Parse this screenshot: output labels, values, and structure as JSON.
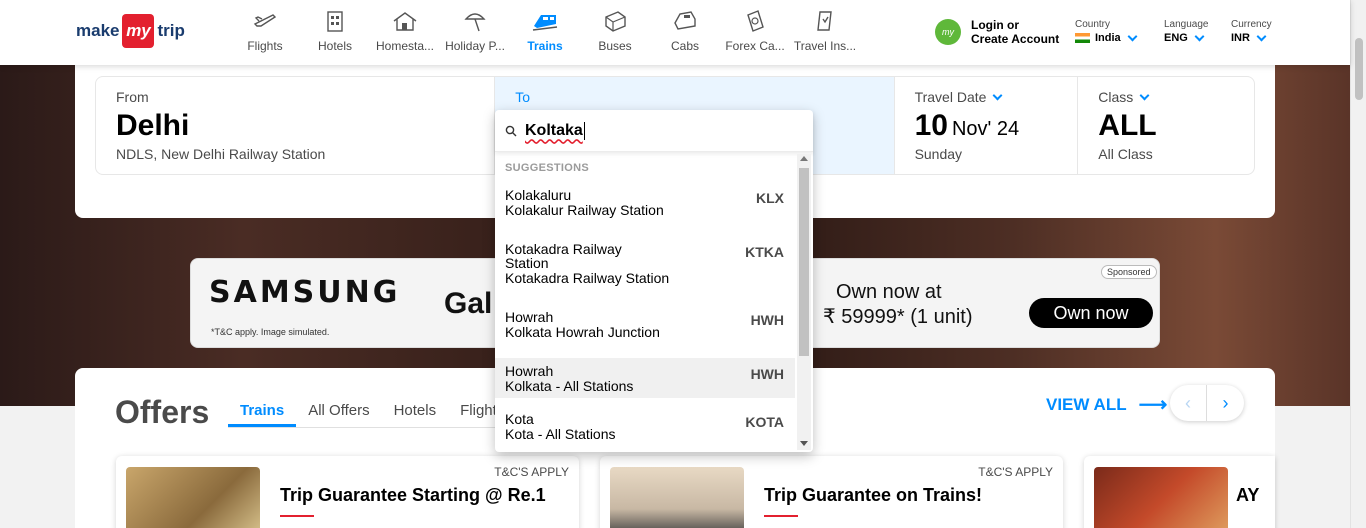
{
  "header": {
    "logo": {
      "make": "make",
      "my": "my",
      "trip": "trip"
    },
    "nav": [
      {
        "label": "Flights",
        "icon": "flight-icon",
        "active": false
      },
      {
        "label": "Hotels",
        "icon": "hotel-icon",
        "active": false
      },
      {
        "label": "Homesta...",
        "icon": "homestay-icon",
        "active": false
      },
      {
        "label": "Holiday P...",
        "icon": "holiday-icon",
        "active": false
      },
      {
        "label": "Trains",
        "icon": "train-icon",
        "active": true
      },
      {
        "label": "Buses",
        "icon": "bus-icon",
        "active": false
      },
      {
        "label": "Cabs",
        "icon": "cab-icon",
        "active": false
      },
      {
        "label": "Forex Ca...",
        "icon": "forex-icon",
        "active": false
      },
      {
        "label": "Travel Ins...",
        "icon": "insurance-icon",
        "active": false
      }
    ],
    "login": {
      "line1": "Login or",
      "line2": "Create Account",
      "badge": "my"
    },
    "country": {
      "label": "Country",
      "value": "India"
    },
    "language": {
      "label": "Language",
      "value": "ENG"
    },
    "currency": {
      "label": "Currency",
      "value": "INR"
    }
  },
  "search": {
    "from": {
      "label": "From",
      "city": "Delhi",
      "station": "NDLS, New Delhi Railway Station"
    },
    "to": {
      "label": "To"
    },
    "date": {
      "label": "Travel Date",
      "day": "10",
      "month": "Nov' 24",
      "weekday": "Sunday"
    },
    "class": {
      "label": "Class",
      "value": "ALL",
      "sub": "All Class"
    }
  },
  "dropdown": {
    "query": "Koltaka",
    "heading": "SUGGESTIONS",
    "items": [
      {
        "name": "Kolakaluru",
        "station": "Kolakalur Railway Station",
        "code": "KLX"
      },
      {
        "name": "Kotakadra Railway Station",
        "station": "Kotakadra Railway Station",
        "code": "KTKA"
      },
      {
        "name": "Howrah",
        "station": "Kolkata Howrah Junction",
        "code": "HWH"
      },
      {
        "name": "Howrah",
        "station": "Kolkata - All Stations",
        "code": "HWH"
      },
      {
        "name": "Kota",
        "station": "Kota - All Stations",
        "code": "KOTA"
      }
    ]
  },
  "ad": {
    "brand": "SAMSUNG",
    "tc": "*T&C apply. Image simulated.",
    "product": "Gal",
    "own_line1": "Own now at",
    "own_line2": "₹ 59999* (1 unit)",
    "button": "Own now",
    "sponsored": "Sponsored"
  },
  "offers": {
    "title": "Offers",
    "tabs": [
      "Trains",
      "All Offers",
      "Hotels",
      "Flight"
    ],
    "view_all": "VIEW ALL",
    "cards": [
      {
        "tnc": "T&C'S APPLY",
        "title": "Trip Guarantee Starting @ Re.1"
      },
      {
        "tnc": "T&C'S APPLY",
        "title": "Trip Guarantee on Trains!"
      },
      {
        "tnc": "",
        "title": "AY"
      }
    ]
  },
  "colors": {
    "accent": "#008cff",
    "brand_red": "#e3202f"
  }
}
